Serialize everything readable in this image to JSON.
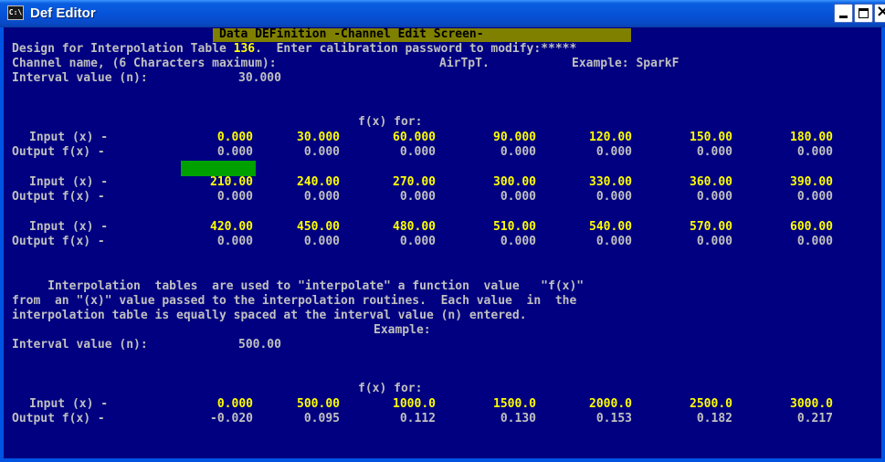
{
  "window": {
    "title": "Def Editor",
    "icon_label": "C:\\"
  },
  "header": "Data DEFinition -Channel Edit Screen-",
  "design_line": {
    "prefix": "Design for Interpolation Table ",
    "table_no": "136",
    "suffix": ".  Enter calibration password to modify:",
    "password": "*****"
  },
  "channel_line": {
    "label": "Channel name, (6 Characters maximum):",
    "name": "AirTpT.",
    "example": "Example: SparkF"
  },
  "interval_line": {
    "label": "Interval value (n):",
    "value": "30.000"
  },
  "fx_header": "f(x) for:",
  "input_label": "Input (x) -",
  "output_label": "Output f(x) -",
  "table": [
    {
      "inputs": [
        "0.000",
        "30.000",
        "60.000",
        "90.000",
        "120.00",
        "150.00",
        "180.00"
      ],
      "outputs": [
        "0.000",
        "0.000",
        "0.000",
        "0.000",
        "0.000",
        "0.000",
        "0.000"
      ]
    },
    {
      "inputs": [
        "210.00",
        "240.00",
        "270.00",
        "300.00",
        "330.00",
        "360.00",
        "390.00"
      ],
      "outputs": [
        "0.000",
        "0.000",
        "0.000",
        "0.000",
        "0.000",
        "0.000",
        "0.000"
      ]
    },
    {
      "inputs": [
        "420.00",
        "450.00",
        "480.00",
        "510.00",
        "540.00",
        "570.00",
        "600.00"
      ],
      "outputs": [
        "0.000",
        "0.000",
        "0.000",
        "0.000",
        "0.000",
        "0.000",
        "0.000"
      ]
    }
  ],
  "help": {
    "line1": "     Interpolation  tables  are used to \"interpolate\" a function  value   \"f(x)\"",
    "line2": "from  an \"(x)\" value passed to the interpolation routines.  Each value  in  the",
    "line3": "interpolation table is equally spaced at the interval value (n) entered.",
    "example_label": "Example:"
  },
  "example": {
    "interval_label": "Interval value (n):",
    "interval_value": "500.00",
    "fx_header": "f(x) for:",
    "inputs": [
      "0.000",
      "500.00",
      "1000.0",
      "1500.0",
      "2000.0",
      "2500.0",
      "3000.0"
    ],
    "outputs": [
      "-0.020",
      "0.095",
      "0.112",
      "0.130",
      "0.153",
      "0.182",
      "0.217"
    ]
  }
}
